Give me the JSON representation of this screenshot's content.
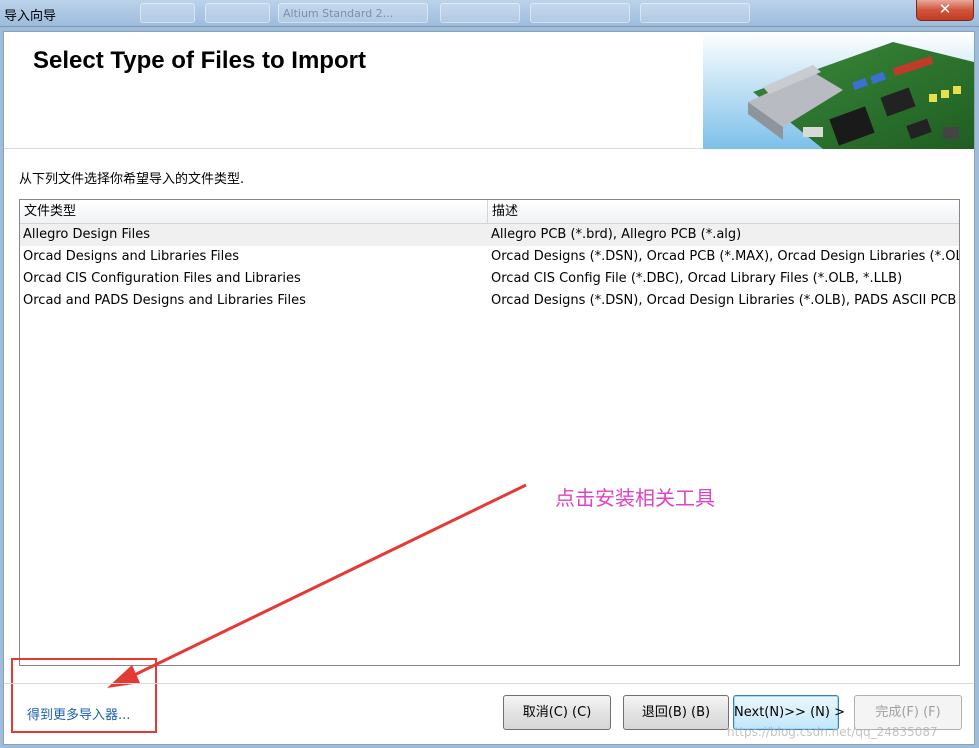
{
  "window": {
    "title": "导入向导",
    "background_hint": "Altium Standard 2..."
  },
  "header": {
    "title": "Select Type of Files to Import"
  },
  "instruction": "从下列文件选择你希望导入的文件类型.",
  "list": {
    "columns": [
      "文件类型",
      "描述"
    ],
    "rows": [
      {
        "type": "Allegro Design Files",
        "description": "Allegro PCB (*.brd), Allegro PCB (*.alg)"
      },
      {
        "type": "Orcad Designs and Libraries Files",
        "description": "Orcad Designs (*.DSN), Orcad PCB (*.MAX), Orcad Design Libraries (*.OLB), O"
      },
      {
        "type": "Orcad CIS Configuration Files and Libraries",
        "description": "Orcad CIS Config File (*.DBC), Orcad Library Files (*.OLB, *.LLB)"
      },
      {
        "type": "Orcad and PADS Designs and Libraries Files",
        "description": "Orcad Designs (*.DSN), Orcad Design Libraries (*.OLB), PADS ASCII PCB (*.AS"
      }
    ]
  },
  "annotation": {
    "text": "点击安装相关工具",
    "color": "#e043c9",
    "arrow_color": "#e53935"
  },
  "footer": {
    "more_importers": "得到更多导入器...",
    "cancel": "取消(C) (C)",
    "back": "退回(B) (B)",
    "next": "Next(N)>> (N) >",
    "finish": "完成(F) (F)"
  },
  "watermark": "https://blog.csdn.net/qq_24835087",
  "colors": {
    "link": "#1a5fb4",
    "titlebar": "#a9c5e2",
    "close_button": "#c23b22"
  }
}
